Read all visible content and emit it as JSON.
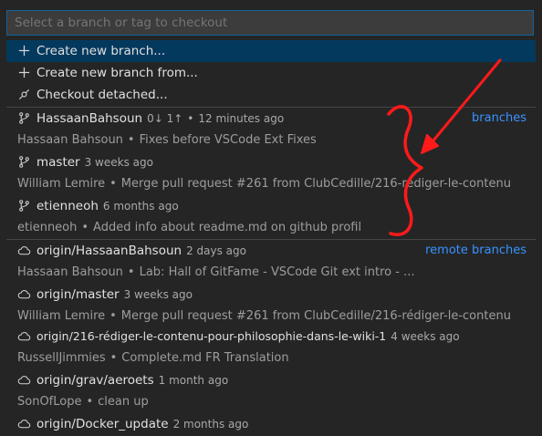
{
  "search": {
    "placeholder": "Select a branch or tag to checkout"
  },
  "actions": [
    {
      "label": "Create new branch...",
      "icon": "plus-icon"
    },
    {
      "label": "Create new branch from...",
      "icon": "plus-icon"
    },
    {
      "label": "Checkout detached...",
      "icon": "git-commit-icon"
    }
  ],
  "groups": {
    "branches": "branches",
    "remote_branches": "remote branches"
  },
  "branches": [
    {
      "name": "HassaanBahsoun",
      "sync": "0↓ 1↑",
      "bullet": "•",
      "time": "12 minutes ago",
      "author": "Hassaan Bahsoun",
      "message": "Fixes before VSCode Ext Fixes"
    },
    {
      "name": "master",
      "time": "3 weeks ago",
      "author": "William Lemire",
      "message": "Merge pull request #261 from ClubCedille/216-rédiger-le-contenu"
    },
    {
      "name": "etienneoh",
      "time": "6 months ago",
      "author": "etienneoh",
      "message": "Added info about readme.md on github profil"
    }
  ],
  "remote_branches": [
    {
      "name": "origin/HassaanBahsoun",
      "time": "2 days ago",
      "author": "Hassaan Bahsoun",
      "message": "Lab: Hall of GitFame - VSCode Git ext intro - ..."
    },
    {
      "name": "origin/master",
      "time": "3 weeks ago",
      "author": "William Lemire",
      "message": "Merge pull request #261 from ClubCedille/216-rédiger-le-contenu"
    },
    {
      "name": "origin/216-rédiger-le-contenu-pour-philosophie-dans-le-wiki-1",
      "time": "4 weeks ago",
      "author": "RussellJimmies",
      "message": "Complete.md FR Translation"
    },
    {
      "name": "origin/grav/aeroets",
      "time": "1 month ago",
      "author": "SonOfLope",
      "message": "clean up"
    },
    {
      "name": "origin/Docker_update",
      "time": "2 months ago",
      "author": "",
      "message": ""
    }
  ],
  "separator": "•",
  "colors": {
    "accent": "#3794ff",
    "selection": "#04395e",
    "annotation": "#ff1a1a",
    "focus_border": "#0e639c"
  }
}
